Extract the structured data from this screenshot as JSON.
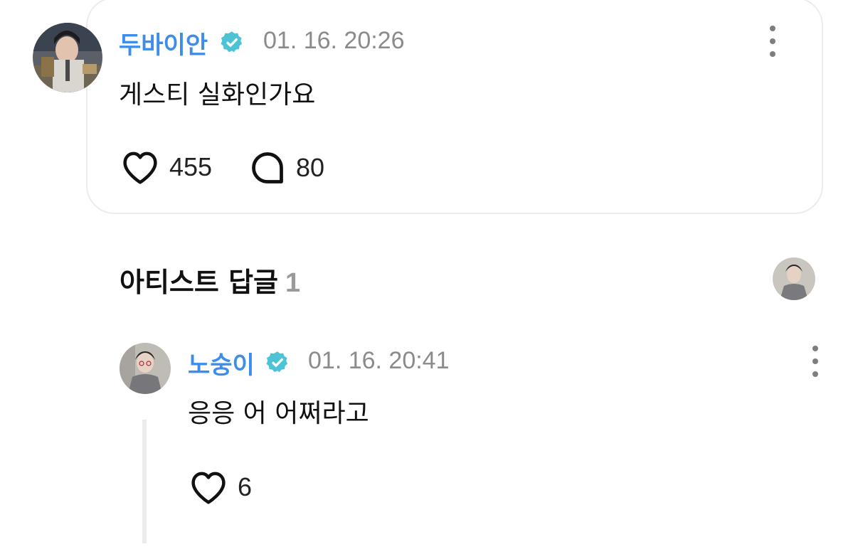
{
  "comment": {
    "username": "두바이안",
    "verified_icon": "verified-badge-icon",
    "timestamp": "01. 16. 20:26",
    "text": "게스티 실화인가요",
    "likes": "455",
    "replies": "80"
  },
  "artist_section": {
    "title": "아티스트 답글",
    "count": "1"
  },
  "reply": {
    "username": "노숭이",
    "verified_icon": "verified-badge-icon",
    "timestamp": "01. 16. 20:41",
    "text": "응응 어 어쩌라고",
    "likes": "6"
  },
  "colors": {
    "username": "#3d8eea",
    "verified": "#4fc3d6",
    "timestamp": "#8b8b8b",
    "card_border": "#ececec"
  }
}
